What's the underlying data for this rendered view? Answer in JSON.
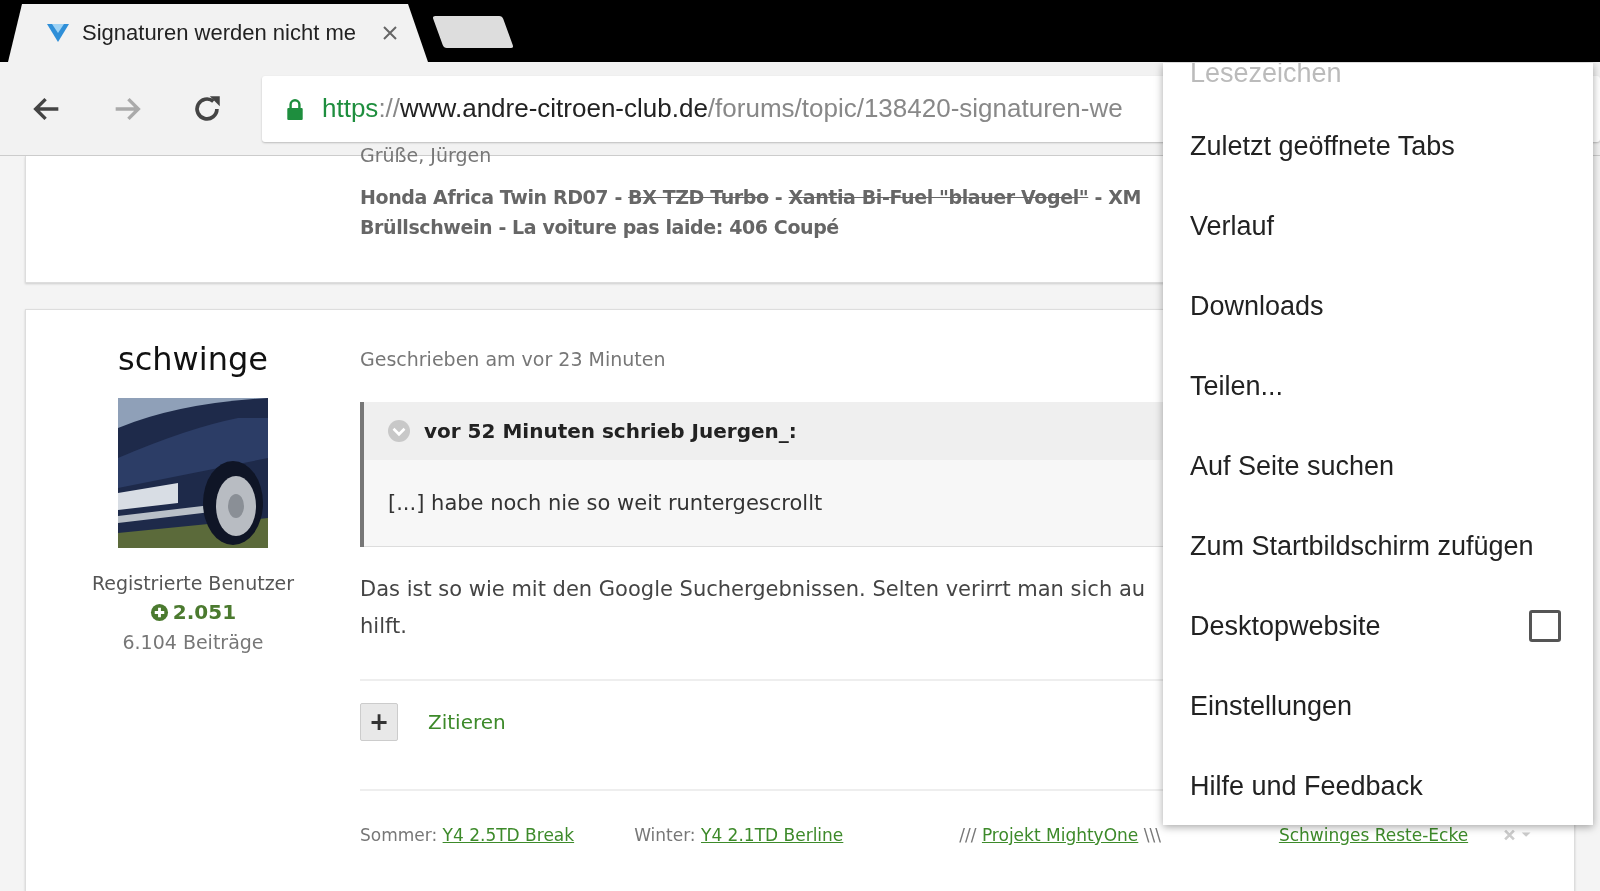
{
  "browser": {
    "tab": {
      "title": "Signaturen werden nicht me"
    },
    "url": [
      {
        "kind": "scheme",
        "text": "https"
      },
      {
        "kind": "dim",
        "text": "://"
      },
      {
        "kind": "host",
        "text": "www.andre-citroen-club.de"
      },
      {
        "kind": "dim",
        "text": "/forums/topic/138420-signaturen-we"
      }
    ]
  },
  "previous_post": {
    "greeting": "Grüße, Jürgen",
    "signature": [
      [
        {
          "text": "Honda Africa Twin RD07 - ",
          "struck": false
        },
        {
          "text": "BX TZD Turbo",
          "struck": true
        },
        {
          "text": " - ",
          "struck": false
        },
        {
          "text": "Xantia Bi-Fuel \"blauer Vogel\"",
          "struck": true
        },
        {
          "text": " - XM",
          "struck": false
        }
      ],
      [
        {
          "text": "Brüllschwein - La voiture pas laide: 406 Coupé",
          "struck": false
        }
      ]
    ]
  },
  "post": {
    "author": "schwinge",
    "role": "Registrierte Benutzer",
    "reputation": "2.051",
    "posts": "6.104 Beiträge",
    "date": "Geschrieben am vor 23 Minuten",
    "quote": {
      "header": "vor 52 Minuten schrieb Juergen_:",
      "text": "[...] habe noch nie so weit runtergescrollt"
    },
    "body": [
      "Das ist so wie mit den Google Suchergebnissen. Selten verirrt man sich au",
      "hilft."
    ],
    "quote_button": "+",
    "quote_link": "Zitieren",
    "signature": [
      {
        "kind": "text",
        "text": "Sommer: "
      },
      {
        "kind": "link",
        "text": "Y4 2.5TD Break"
      },
      {
        "kind": "gap"
      },
      {
        "kind": "text",
        "text": "Winter: "
      },
      {
        "kind": "link",
        "text": "Y4 2.1TD Berline"
      },
      {
        "kind": "gap"
      },
      {
        "kind": "text",
        "text": "/// "
      },
      {
        "kind": "link",
        "text": "Projekt MightyOne"
      },
      {
        "kind": "text",
        "text": " \\\\\\"
      },
      {
        "kind": "gap"
      },
      {
        "kind": "link",
        "text": "Schwinges Reste-Ecke"
      }
    ]
  },
  "menu": {
    "items": [
      {
        "kind": "faded",
        "label": "Lesezeichen"
      },
      {
        "kind": "plain",
        "label": "Zuletzt geöffnete Tabs"
      },
      {
        "kind": "plain",
        "label": "Verlauf"
      },
      {
        "kind": "plain",
        "label": "Downloads"
      },
      {
        "kind": "plain",
        "label": "Teilen..."
      },
      {
        "kind": "plain",
        "label": "Auf Seite suchen"
      },
      {
        "kind": "plain",
        "label": "Zum Startbildschirm zufügen"
      },
      {
        "kind": "checkbox",
        "label": "Desktopwebsite",
        "checked": false
      },
      {
        "kind": "plain",
        "label": "Einstellungen"
      },
      {
        "kind": "plain",
        "label": "Hilfe und Feedback"
      }
    ]
  }
}
